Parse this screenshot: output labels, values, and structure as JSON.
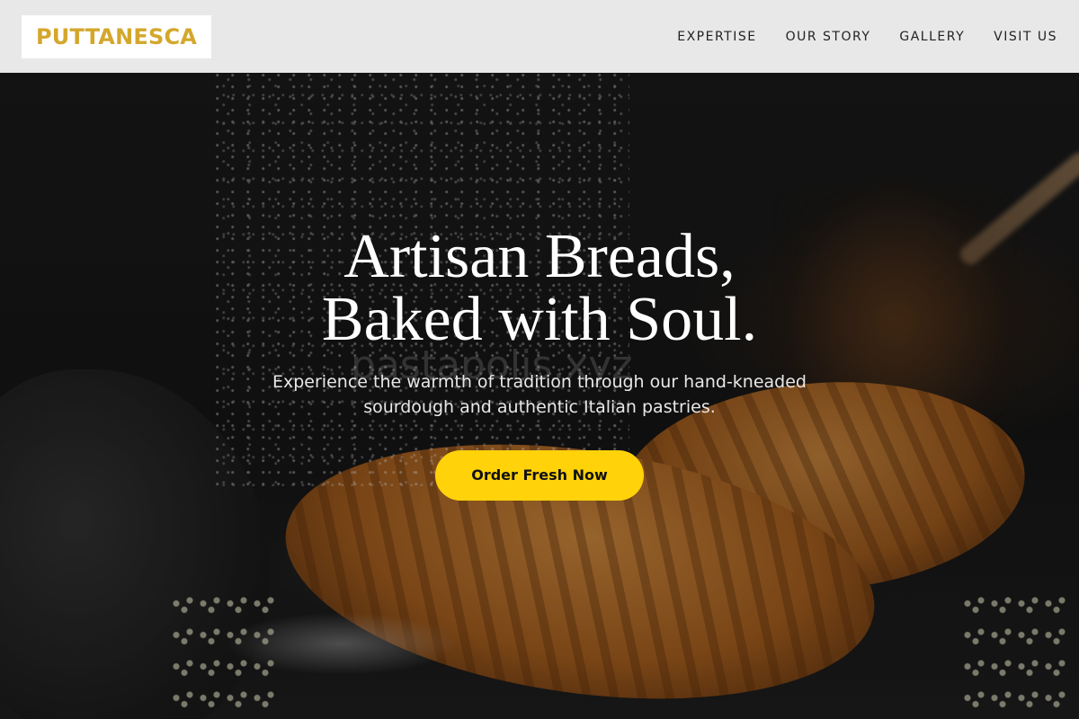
{
  "header": {
    "logo": "PUTTANESCA",
    "nav": [
      {
        "label": "EXPERTISE"
      },
      {
        "label": "OUR STORY"
      },
      {
        "label": "GALLERY"
      },
      {
        "label": "VISIT US"
      }
    ]
  },
  "hero": {
    "title_line1": "Artisan Breads,",
    "title_line2": "Baked with Soul.",
    "subtitle_line1": "Experience the warmth of tradition through our hand-kneaded",
    "subtitle_line2": "sourdough and authentic Italian pastries.",
    "cta_label": "Order Fresh Now",
    "watermark": "pastapolis.xyz"
  },
  "colors": {
    "logo": "#d4a72c",
    "cta": "#ffd20a",
    "navbar_bg": "#e8e8e8"
  }
}
